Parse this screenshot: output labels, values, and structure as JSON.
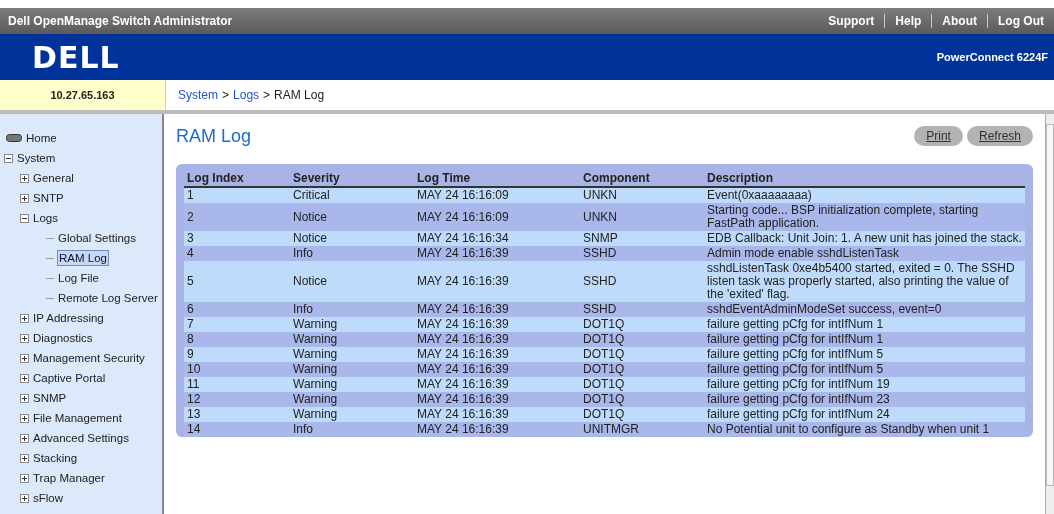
{
  "top_bar": {
    "title": "Dell OpenManage Switch Administrator",
    "links": [
      "Support",
      "Help",
      "About",
      "Log Out"
    ]
  },
  "banner": {
    "logo": "DELL",
    "model": "PowerConnect 6224F"
  },
  "ip_address": "10.27.65.163",
  "breadcrumb": [
    {
      "label": "System",
      "link": true
    },
    {
      "label": ">",
      "link": false
    },
    {
      "label": "Logs",
      "link": true
    },
    {
      "label": ">",
      "link": false
    },
    {
      "label": "RAM Log",
      "link": false
    }
  ],
  "sidebar": {
    "items": [
      {
        "label": "Home",
        "kind": "home",
        "selected": false
      },
      {
        "label": "System",
        "kind": "folder",
        "expanded": true,
        "selected": false,
        "children": [
          {
            "label": "General",
            "kind": "folder",
            "expanded": false,
            "selected": false
          },
          {
            "label": "SNTP",
            "kind": "folder",
            "expanded": false,
            "selected": false
          },
          {
            "label": "Logs",
            "kind": "folder",
            "expanded": true,
            "selected": false,
            "children": [
              {
                "label": "Global Settings",
                "kind": "page",
                "selected": false
              },
              {
                "label": "RAM Log",
                "kind": "page",
                "selected": true
              },
              {
                "label": "Log File",
                "kind": "page",
                "selected": false
              },
              {
                "label": "Remote Log Server",
                "kind": "page",
                "selected": false
              }
            ]
          },
          {
            "label": "IP Addressing",
            "kind": "folder",
            "expanded": false,
            "selected": false
          },
          {
            "label": "Diagnostics",
            "kind": "folder",
            "expanded": false,
            "selected": false
          },
          {
            "label": "Management Security",
            "kind": "folder",
            "expanded": false,
            "selected": false
          },
          {
            "label": "Captive Portal",
            "kind": "folder",
            "expanded": false,
            "selected": false
          },
          {
            "label": "SNMP",
            "kind": "folder",
            "expanded": false,
            "selected": false
          },
          {
            "label": "File Management",
            "kind": "folder",
            "expanded": false,
            "selected": false
          },
          {
            "label": "Advanced Settings",
            "kind": "folder",
            "expanded": false,
            "selected": false
          },
          {
            "label": "Stacking",
            "kind": "folder",
            "expanded": false,
            "selected": false
          },
          {
            "label": "Trap Manager",
            "kind": "folder",
            "expanded": false,
            "selected": false
          },
          {
            "label": "sFlow",
            "kind": "folder",
            "expanded": false,
            "selected": false
          }
        ]
      }
    ]
  },
  "page_title": "RAM Log",
  "buttons": [
    "Print",
    "Refresh"
  ],
  "table": {
    "columns": [
      "Log Index",
      "Severity",
      "Log Time",
      "Component",
      "Description"
    ],
    "rows": [
      [
        "1",
        "Critical",
        "MAY 24 16:16:09",
        "UNKN",
        "Event(0xaaaaaaaa)"
      ],
      [
        "2",
        "Notice",
        "MAY 24 16:16:09",
        "UNKN",
        "Starting code... BSP initialization complete, starting FastPath application."
      ],
      [
        "3",
        "Notice",
        "MAY 24 16:16:34",
        "SNMP",
        "EDB Callback: Unit Join: 1. A new unit has joined the stack."
      ],
      [
        "4",
        "Info",
        "MAY 24 16:16:39",
        "SSHD",
        "Admin mode enable sshdListenTask"
      ],
      [
        "5",
        "Notice",
        "MAY 24 16:16:39",
        "SSHD",
        "sshdListenTask 0xe4b5400 started, exited = 0. The SSHD listen task was properly started, also printing the value of the 'exited' flag."
      ],
      [
        "6",
        "Info",
        "MAY 24 16:16:39",
        "SSHD",
        "sshdEventAdminModeSet success, event=0"
      ],
      [
        "7",
        "Warning",
        "MAY 24 16:16:39",
        "DOT1Q",
        "failure getting pCfg for intIfNum 1"
      ],
      [
        "8",
        "Warning",
        "MAY 24 16:16:39",
        "DOT1Q",
        "failure getting pCfg for intIfNum 1"
      ],
      [
        "9",
        "Warning",
        "MAY 24 16:16:39",
        "DOT1Q",
        "failure getting pCfg for intIfNum 5"
      ],
      [
        "10",
        "Warning",
        "MAY 24 16:16:39",
        "DOT1Q",
        "failure getting pCfg for intIfNum 5"
      ],
      [
        "11",
        "Warning",
        "MAY 24 16:16:39",
        "DOT1Q",
        "failure getting pCfg for intIfNum 19"
      ],
      [
        "12",
        "Warning",
        "MAY 24 16:16:39",
        "DOT1Q",
        "failure getting pCfg for intIfNum 23"
      ],
      [
        "13",
        "Warning",
        "MAY 24 16:16:39",
        "DOT1Q",
        "failure getting pCfg for intIfNum 24"
      ],
      [
        "14",
        "Info",
        "MAY 24 16:16:39",
        "UNITMGR",
        "No Potential unit to configure as Standby when unit 1"
      ]
    ]
  }
}
